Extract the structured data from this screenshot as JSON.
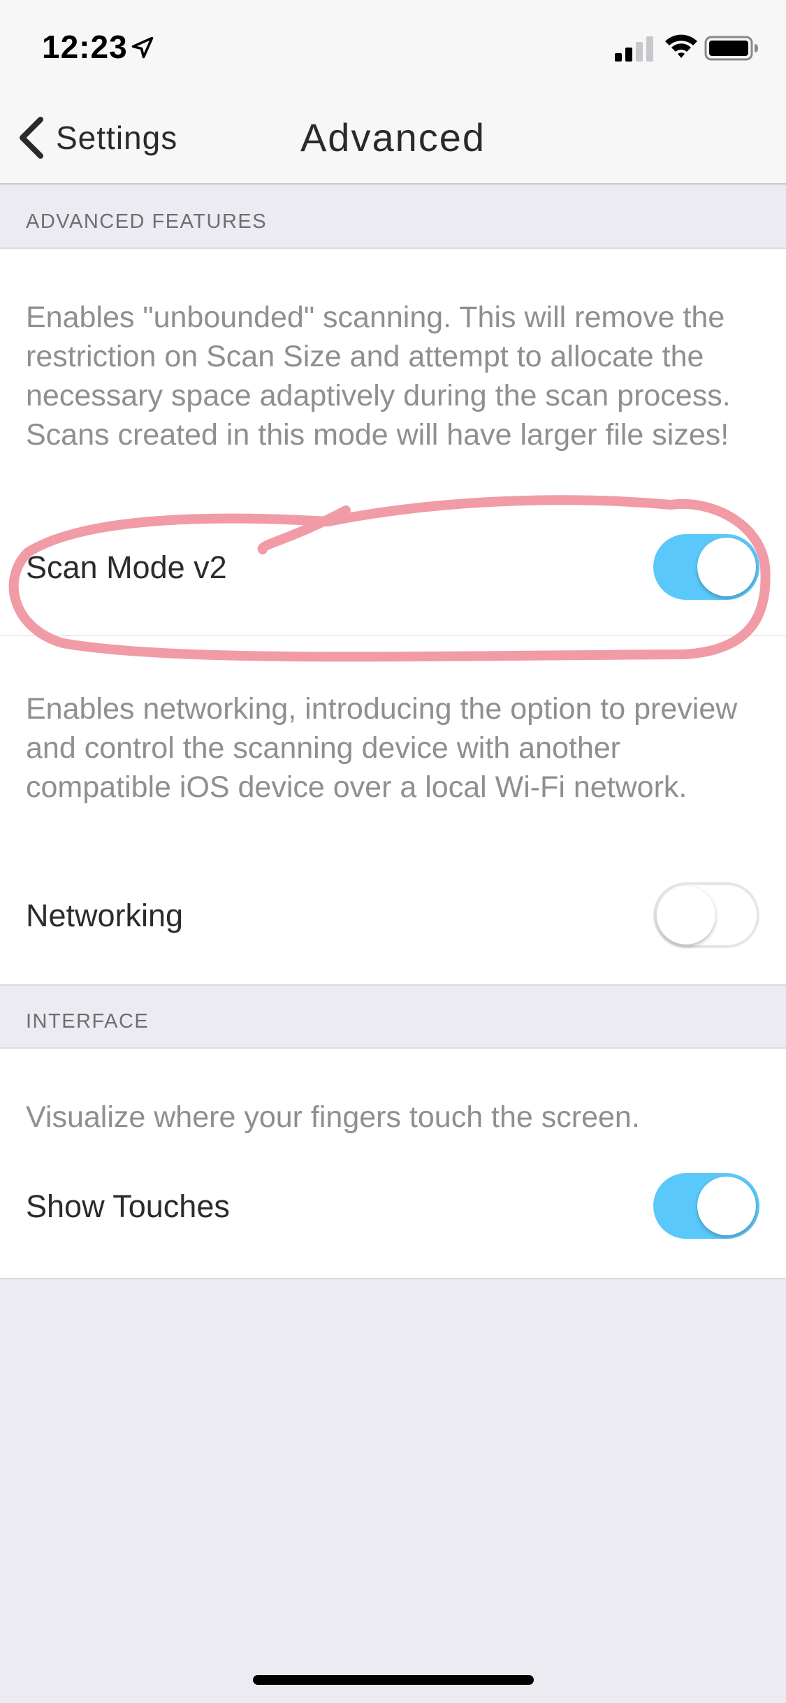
{
  "status_bar": {
    "time": "12:23",
    "icons": [
      "location-arrow-icon",
      "cellular-signal-icon",
      "wifi-icon",
      "battery-icon"
    ]
  },
  "nav": {
    "back_label": "Settings",
    "title": "Advanced"
  },
  "sections": {
    "advanced_features": {
      "header": "ADVANCED FEATURES",
      "scan_mode": {
        "description": "Enables \"unbounded\" scanning. This will remove the restriction on Scan Size and attempt to allocate the necessary space adaptively during the scan process. Scans created in this mode will have larger file sizes!",
        "label": "Scan Mode v2",
        "enabled": true
      },
      "networking": {
        "description": "Enables networking, introducing the option to preview and control the scanning device with another compatible iOS device over a local Wi-Fi network.",
        "label": "Networking",
        "enabled": false
      }
    },
    "interface": {
      "header": "INTERFACE",
      "show_touches": {
        "description": "Visualize where your fingers touch the screen.",
        "label": "Show Touches",
        "enabled": true
      }
    }
  },
  "colors": {
    "toggle_on": "#5ac8fa",
    "annotation": "#f0939e",
    "background": "#ebebf1"
  }
}
